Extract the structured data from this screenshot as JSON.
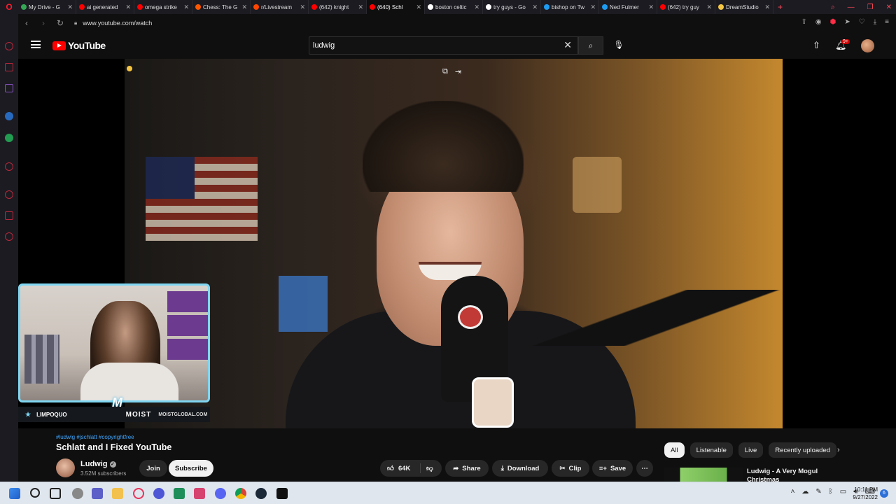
{
  "browser": {
    "tabs": [
      {
        "label": "My Drive - G",
        "color": "#34a853"
      },
      {
        "label": "ai generated",
        "color": "#ff0000"
      },
      {
        "label": "omega strike",
        "color": "#ff0000"
      },
      {
        "label": "Chess: The G",
        "color": "#ff5700"
      },
      {
        "label": "r/Livestream",
        "color": "#ff4500"
      },
      {
        "label": "(642) knight",
        "color": "#ff0000"
      },
      {
        "label": "(640) Schl",
        "color": "#ff0000",
        "active": true
      },
      {
        "label": "boston celtic",
        "color": "#ffffff"
      },
      {
        "label": "try guys - Go",
        "color": "#ffffff"
      },
      {
        "label": "bishop on Tw",
        "color": "#1d9bf0"
      },
      {
        "label": "Ned Fulmer",
        "color": "#1d9bf0"
      },
      {
        "label": "(642) try guy",
        "color": "#ff0000"
      },
      {
        "label": "DreamStudio",
        "color": "#f5c542"
      }
    ],
    "new_tab": "+",
    "url": "www.youtube.com/watch"
  },
  "youtube": {
    "logo_text": "YouTube",
    "search_value": "ludwig",
    "notification_count": "9+"
  },
  "webcam": {
    "streamer_name": "LIMPOQUO",
    "brand": "MOIST",
    "site": "MOISTGLOBAL.COM",
    "logo_letter": "M"
  },
  "video": {
    "hashtags": "#ludwig #jschlatt #copyrightfree",
    "title": "Schlatt and I Fixed YouTube",
    "channel": "Ludwig",
    "subscribers": "3.52M subscribers",
    "join_label": "Join",
    "subscribe_label": "Subscribe",
    "likes": "64K",
    "share_label": "Share",
    "download_label": "Download",
    "clip_label": "Clip",
    "save_label": "Save",
    "more_label": "⋯"
  },
  "sidebar_recs": {
    "chips": [
      "All",
      "Listenable",
      "Live",
      "Recently uploaded"
    ],
    "first_title": "Ludwig - A Very Mogul Christmas"
  },
  "taskbar": {
    "time": "10:11 PM",
    "date": "9/27/2022",
    "notification": "6"
  }
}
